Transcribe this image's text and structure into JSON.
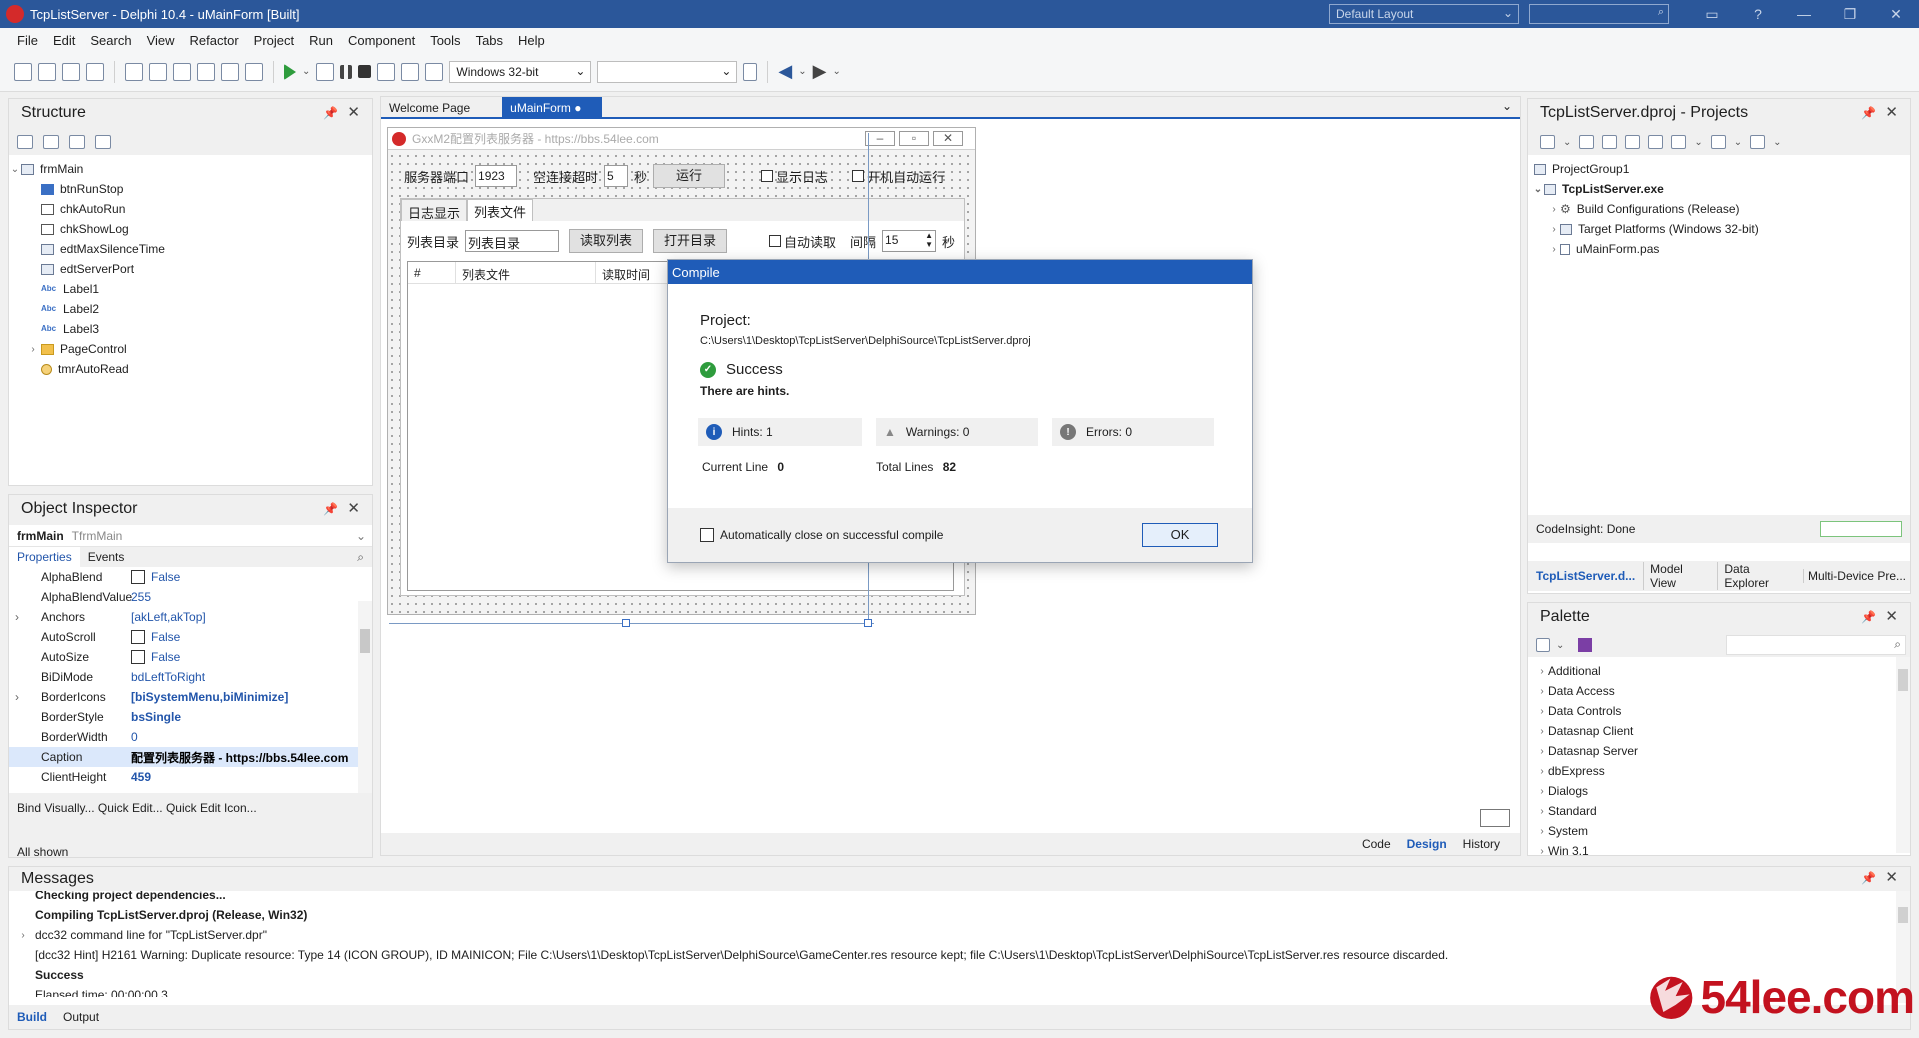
{
  "titlebar": {
    "title": "TcpListServer - Delphi 10.4 - uMainForm [Built]",
    "layout": "Default Layout",
    "help": "?"
  },
  "menu": [
    "File",
    "Edit",
    "Search",
    "View",
    "Refactor",
    "Project",
    "Run",
    "Component",
    "Tools",
    "Tabs",
    "Help"
  ],
  "toolbar": {
    "platform": "Windows 32-bit",
    "config": ""
  },
  "structure": {
    "title": "Structure",
    "root": "frmMain",
    "items": [
      "btnRunStop",
      "chkAutoRun",
      "chkShowLog",
      "edtMaxSilenceTime",
      "edtServerPort",
      "Label1",
      "Label2",
      "Label3",
      "PageControl",
      "tmrAutoRead"
    ]
  },
  "inspector": {
    "title": "Object Inspector",
    "object": "frmMain",
    "class": "TfrmMain",
    "tabs": [
      "Properties",
      "Events"
    ],
    "rows": [
      {
        "name": "AlphaBlend",
        "value": "False",
        "check": true
      },
      {
        "name": "AlphaBlendValue",
        "value": "255"
      },
      {
        "name": "Anchors",
        "value": "[akLeft,akTop]",
        "expand": true
      },
      {
        "name": "AutoScroll",
        "value": "False",
        "check": true
      },
      {
        "name": "AutoSize",
        "value": "False",
        "check": true
      },
      {
        "name": "BiDiMode",
        "value": "bdLeftToRight"
      },
      {
        "name": "BorderIcons",
        "value": "[biSystemMenu,biMinimize]",
        "expand": true,
        "bold": true
      },
      {
        "name": "BorderStyle",
        "value": "bsSingle",
        "bold": true
      },
      {
        "name": "BorderWidth",
        "value": "0"
      },
      {
        "name": "Caption",
        "value": "配置列表服务器 - https://bbs.54lee.com",
        "bold": true,
        "selected": true
      },
      {
        "name": "ClientHeight",
        "value": "459",
        "bold": true
      }
    ],
    "links": "Bind Visually...  Quick Edit...  Quick Edit Icon...",
    "footer": "All shown"
  },
  "editor_tabs": [
    "Welcome Page",
    "uMainForm"
  ],
  "form": {
    "caption": "GxxM2配置列表服务器 - https://bbs.54lee.com",
    "port_label": "服务器端口",
    "port_value": "1923",
    "idle_label": "空连接超时",
    "idle_value": "5",
    "idle_unit": "秒",
    "run_btn": "运行",
    "show_log": "显示日志",
    "auto_run": "开机自动运行",
    "tabs": [
      "日志显示",
      "列表文件"
    ],
    "dir_label": "列表目录",
    "dir_value": "列表目录",
    "read_btn": "读取列表",
    "open_btn": "打开目录",
    "auto_read": "自动读取",
    "interval_label": "间隔",
    "interval_value": "15",
    "interval_unit": "秒",
    "columns": [
      "#",
      "列表文件",
      "读取时间"
    ]
  },
  "compile": {
    "title": "Compile",
    "project_label": "Project:",
    "project_path": "C:\\Users\\1\\Desktop\\TcpListServer\\DelphiSource\\TcpListServer.dproj",
    "status": "Success",
    "note": "There are hints.",
    "hints": "Hints:  1",
    "warnings": "Warnings:  0",
    "errors": "Errors:  0",
    "current_line_label": "Current Line",
    "current_line": "0",
    "total_lines_label": "Total Lines",
    "total_lines": "82",
    "auto_close": "Automatically close on successful compile",
    "ok": "OK"
  },
  "editor_bottom_tabs": [
    "Code",
    "Design",
    "History"
  ],
  "projects": {
    "title": "TcpListServer.dproj - Projects",
    "items": [
      {
        "label": "ProjectGroup1",
        "level": 0
      },
      {
        "label": "TcpListServer.exe",
        "level": 0,
        "bold": true
      },
      {
        "label": "Build Configurations (Release)",
        "level": 1
      },
      {
        "label": "Target Platforms (Windows 32-bit)",
        "level": 1
      },
      {
        "label": "uMainForm.pas",
        "level": 1
      }
    ],
    "status": "CodeInsight: Done",
    "tabs": [
      "TcpListServer.d...",
      "Model View",
      "Data Explorer",
      "Multi-Device Pre..."
    ]
  },
  "palette": {
    "title": "Palette",
    "items": [
      "Additional",
      "Data Access",
      "Data Controls",
      "Datasnap Client",
      "Datasnap Server",
      "dbExpress",
      "Dialogs",
      "Standard",
      "System",
      "Win 3.1"
    ]
  },
  "messages": {
    "title": "Messages",
    "lines": [
      {
        "text": "Checking project dependencies...",
        "bold": true
      },
      {
        "text": "Compiling TcpListServer.dproj (Release, Win32)",
        "bold": true
      },
      {
        "text": "dcc32 command line for \"TcpListServer.dpr\"",
        "expand": true
      },
      {
        "text": "[dcc32 Hint] H2161 Warning: Duplicate resource:  Type 14 (ICON GROUP), ID MAINICON; File C:\\Users\\1\\Desktop\\TcpListServer\\DelphiSource\\GameCenter.res resource kept; file C:\\Users\\1\\Desktop\\TcpListServer\\DelphiSource\\TcpListServer.res resource discarded."
      },
      {
        "text": "Success",
        "bold": true
      },
      {
        "text": "Elapsed time: 00:00:00.3"
      }
    ],
    "tabs": [
      "Build",
      "Output"
    ]
  },
  "watermark": "54lee.com"
}
